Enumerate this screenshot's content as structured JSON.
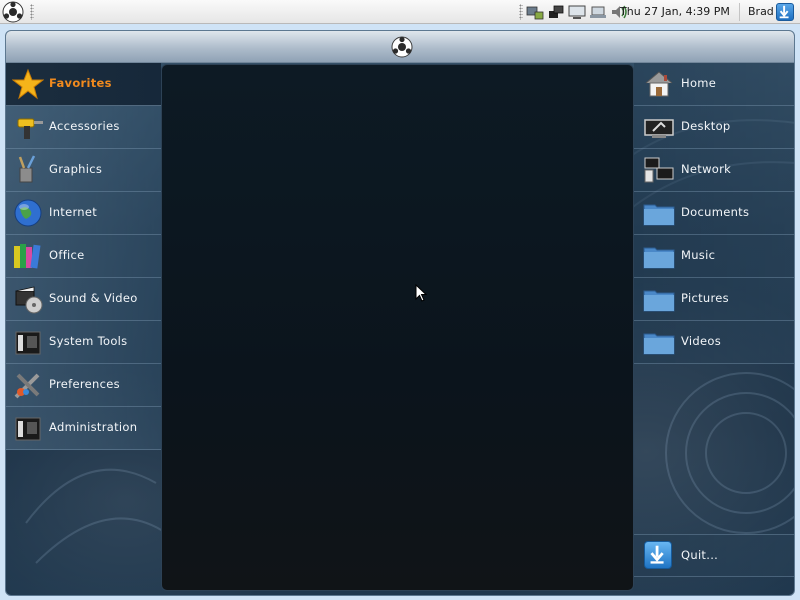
{
  "top_panel": {
    "clock": "Thu 27 Jan,  4:39 PM",
    "user": "Brad",
    "tray_icons": [
      "keyboard-layout-icon",
      "network-manager-icon",
      "display-icon",
      "laptop-power-icon",
      "volume-icon"
    ]
  },
  "categories": [
    {
      "label": "Favorites",
      "icon": "star-icon",
      "active": true
    },
    {
      "label": "Accessories",
      "icon": "drill-icon"
    },
    {
      "label": "Graphics",
      "icon": "brushes-icon"
    },
    {
      "label": "Internet",
      "icon": "globe-icon"
    },
    {
      "label": "Office",
      "icon": "books-icon"
    },
    {
      "label": "Sound & Video",
      "icon": "multimedia-icon"
    },
    {
      "label": "System Tools",
      "icon": "system-tools-icon"
    },
    {
      "label": "Preferences",
      "icon": "tools-icon"
    },
    {
      "label": "Administration",
      "icon": "administration-icon"
    }
  ],
  "places": [
    {
      "label": "Home",
      "icon": "house-icon"
    },
    {
      "label": "Desktop",
      "icon": "desktop-icon"
    },
    {
      "label": "Network",
      "icon": "network-icon"
    },
    {
      "label": "Documents",
      "icon": "folder-icon"
    },
    {
      "label": "Music",
      "icon": "folder-icon"
    },
    {
      "label": "Pictures",
      "icon": "folder-icon"
    },
    {
      "label": "Videos",
      "icon": "folder-icon"
    }
  ],
  "quit": {
    "label": "Quit...",
    "icon": "quit-arrow-icon"
  },
  "colors": {
    "active_category": "#f08a1e",
    "panel_bg": "#0d1a24",
    "launcher_bg": "#223a50"
  }
}
